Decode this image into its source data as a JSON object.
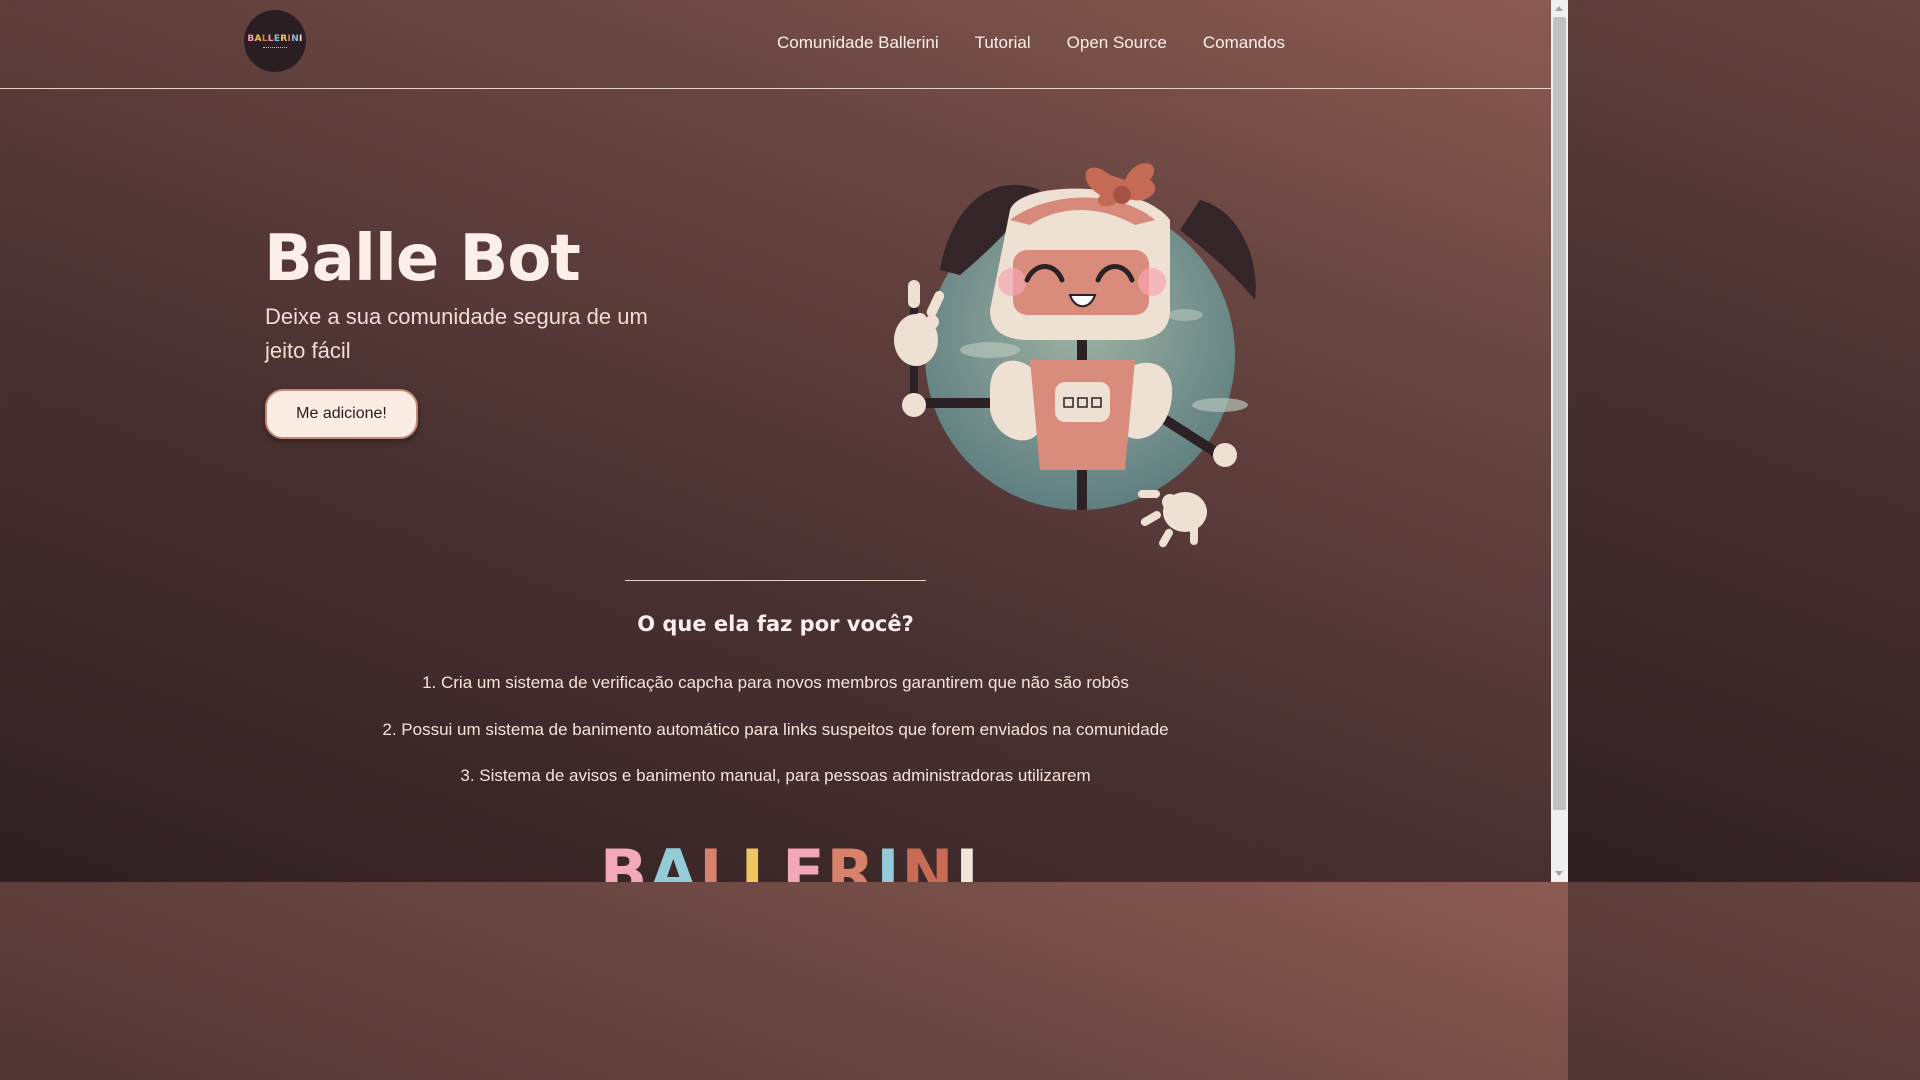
{
  "header": {
    "logo_text": "BALLERINI",
    "nav": [
      {
        "label": "Comunidade Ballerini"
      },
      {
        "label": "Tutorial"
      },
      {
        "label": "Open Source"
      },
      {
        "label": "Comandos"
      }
    ]
  },
  "hero": {
    "title": "Balle Bot",
    "subtitle": "Deixe a sua comunidade segura de um jeito fácil",
    "cta_label": "Me adicione!",
    "illustration_icon": "robot-mascot-icon"
  },
  "features": {
    "title": "O que ela faz por você?",
    "items": [
      "1. Cria um sistema de verificação capcha para novos membros garantirem que não são robôs",
      "2. Possui um sistema de banimento automático para links suspeitos que forem enviados na comunidade",
      "3. Sistema de avisos e banimento manual, para pessoas administradoras utilizarem"
    ]
  },
  "footer_brand": "BALLERINI",
  "colors": {
    "background_start": "#2f1f22",
    "background_end": "#8c5b52",
    "text_light": "#fbefe8",
    "button_bg": "#fbece4"
  }
}
